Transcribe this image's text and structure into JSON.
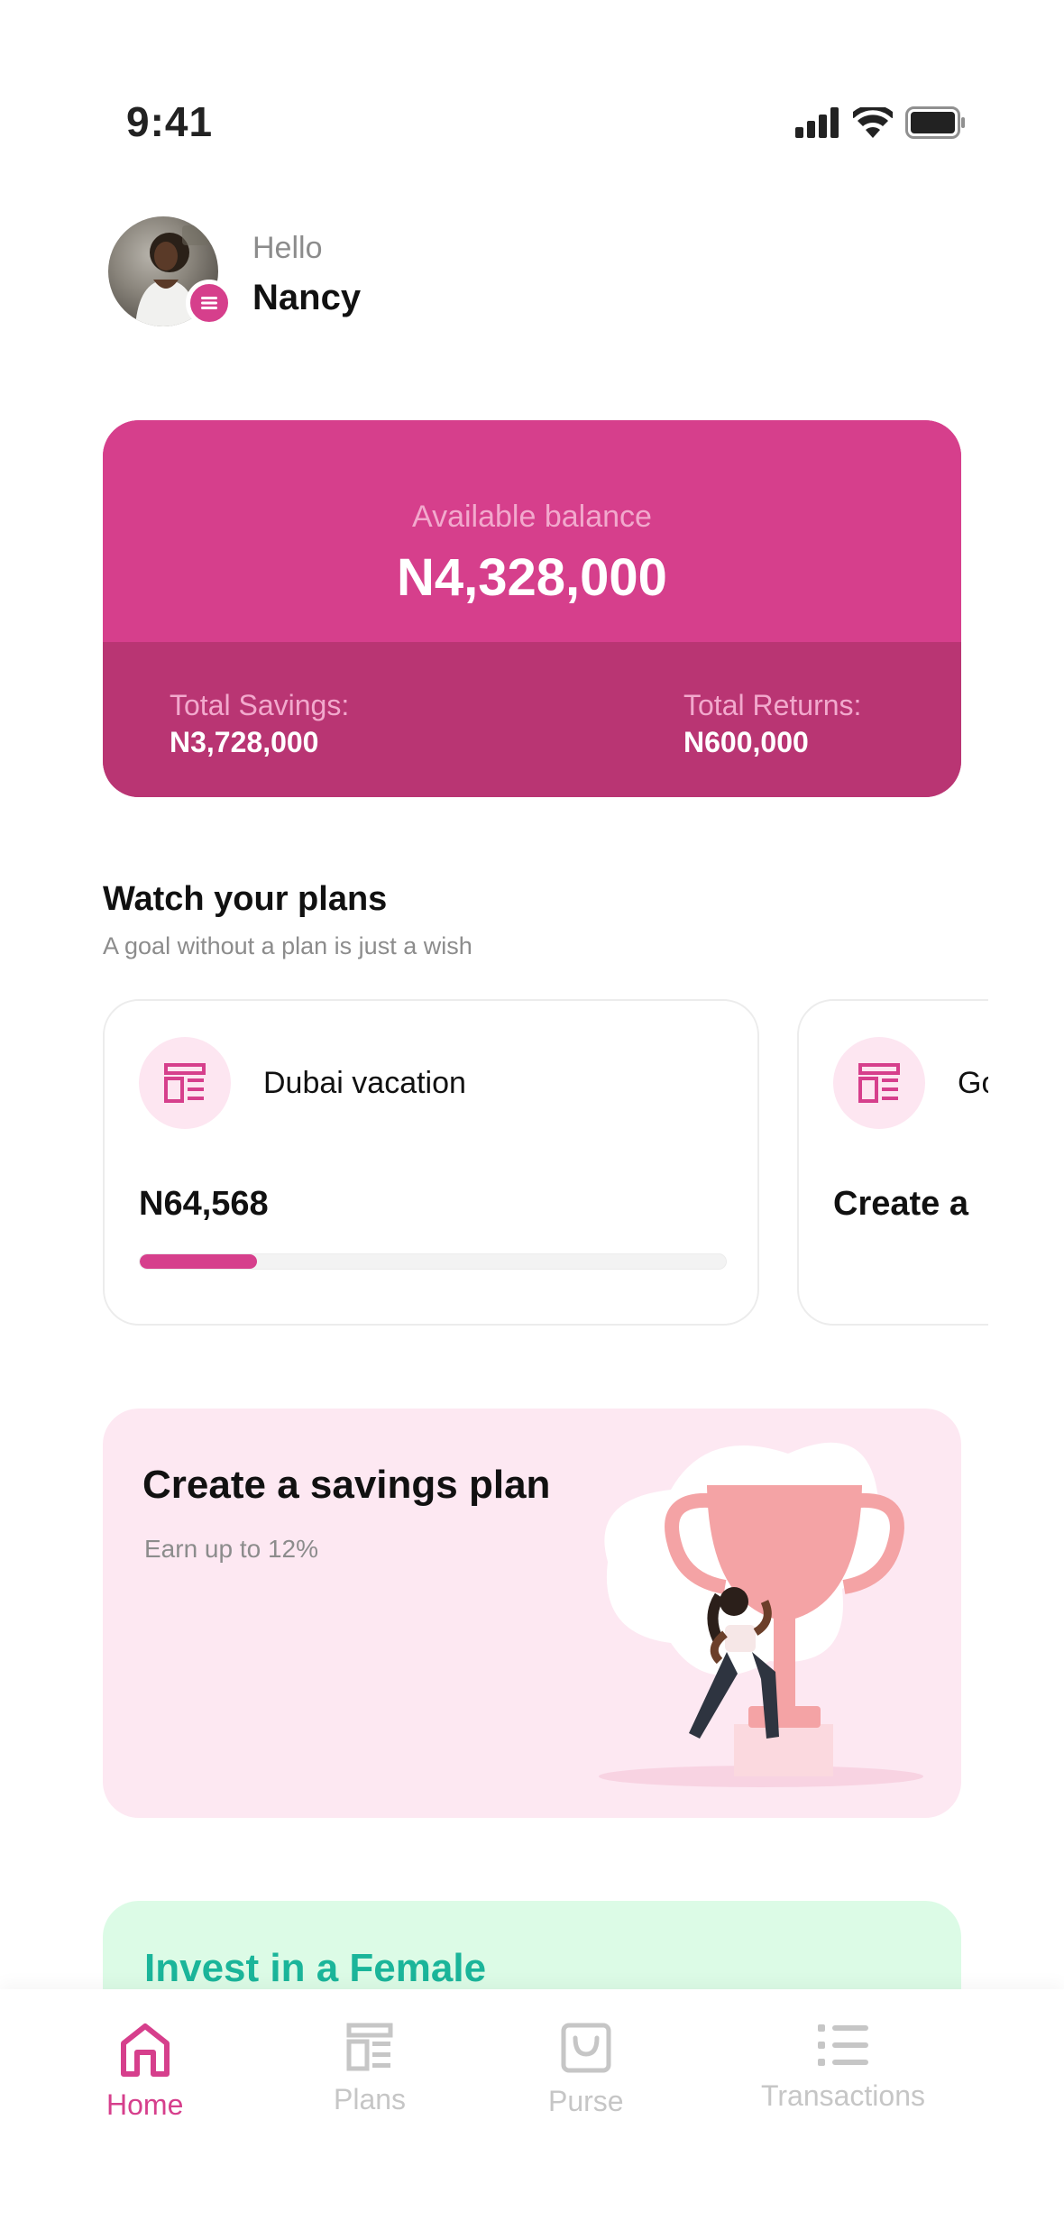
{
  "status_bar": {
    "time": "9:41"
  },
  "greeting": {
    "hello": "Hello",
    "name": "Nancy"
  },
  "balance": {
    "label": "Available balance",
    "value": "N4,328,000",
    "savings_label": "Total Savings:",
    "savings_value": "N3,728,000",
    "returns_label": "Total Returns:",
    "returns_value": "N600,000"
  },
  "plans_section": {
    "title": "Watch your plans",
    "subtitle": "A goal without a plan is just a wish",
    "cards": [
      {
        "name": "Dubai vacation",
        "amount": "N64,568",
        "progress": 0.2
      },
      {
        "name": "Go",
        "amount": "Create a",
        "progress": null
      }
    ]
  },
  "promo": {
    "title": "Create a savings plan",
    "subtitle": "Earn up to 12%"
  },
  "invest": {
    "title": "Invest in a Female"
  },
  "tabs": [
    {
      "label": "Home",
      "icon": "home-icon",
      "active": true
    },
    {
      "label": "Plans",
      "icon": "plans-icon",
      "active": false
    },
    {
      "label": "Purse",
      "icon": "purse-icon",
      "active": false
    },
    {
      "label": "Transactions",
      "icon": "transactions-icon",
      "active": false
    }
  ],
  "colors": {
    "accent": "#d63f8c",
    "accent_dark": "#b93573",
    "promo_bg": "#fde8f2",
    "invest_bg": "#dcfbe6",
    "invest_text": "#1bb59a"
  }
}
